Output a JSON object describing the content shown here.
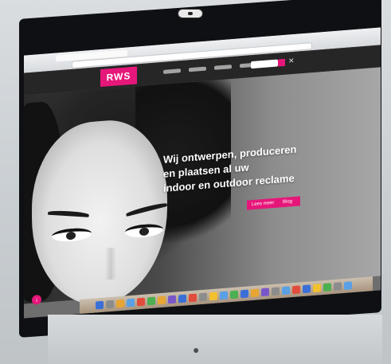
{
  "site": {
    "logo_text": "RWS",
    "hero_lines": [
      "Wij ontwerpen, produceren",
      "en plaatsen al uw",
      "indoor en outdoor reclame"
    ],
    "buttons": [
      "Lees meer",
      "Blog"
    ]
  },
  "colors": {
    "accent": "#e6177a",
    "bezel": "#0f1013",
    "dock": "#b8a590"
  },
  "icons": {
    "camera": "camera-icon",
    "search": "search-icon",
    "scroll": "scroll-down-icon",
    "apple": "apple-logo-icon"
  }
}
